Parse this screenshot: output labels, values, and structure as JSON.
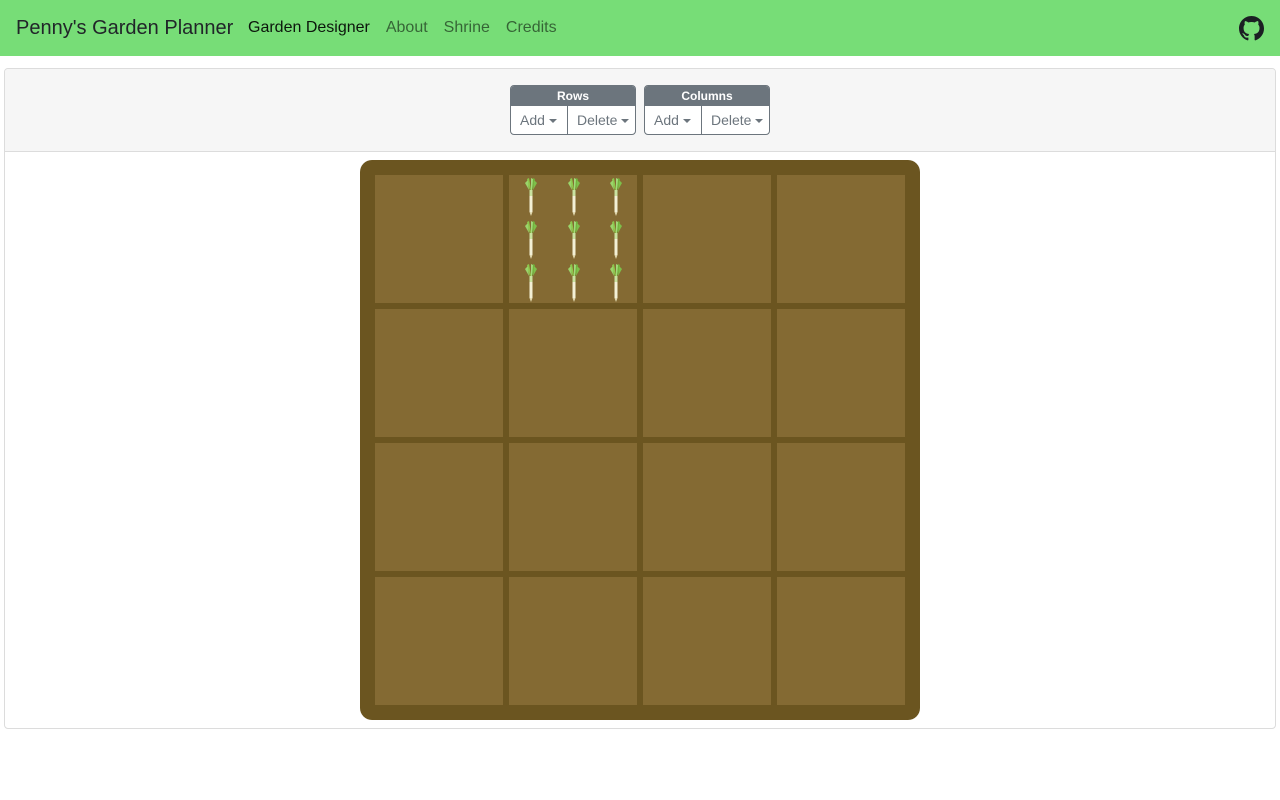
{
  "navbar": {
    "brand": "Penny's Garden Planner",
    "links": [
      {
        "label": "Garden Designer",
        "active": true
      },
      {
        "label": "About",
        "active": false
      },
      {
        "label": "Shrine",
        "active": false
      },
      {
        "label": "Credits",
        "active": false
      }
    ],
    "github_icon": "github-icon",
    "background": "#77dd77"
  },
  "controls": {
    "rows": {
      "title": "Rows",
      "add": "Add",
      "delete": "Delete"
    },
    "columns": {
      "title": "Columns",
      "add": "Add",
      "delete": "Delete"
    }
  },
  "garden": {
    "rows": 4,
    "columns": 4,
    "soil_color": "#846a33",
    "border_color": "#6b5520",
    "plots": [
      {
        "row": 0,
        "col": 1,
        "plant": "leek",
        "count": 9
      }
    ]
  }
}
